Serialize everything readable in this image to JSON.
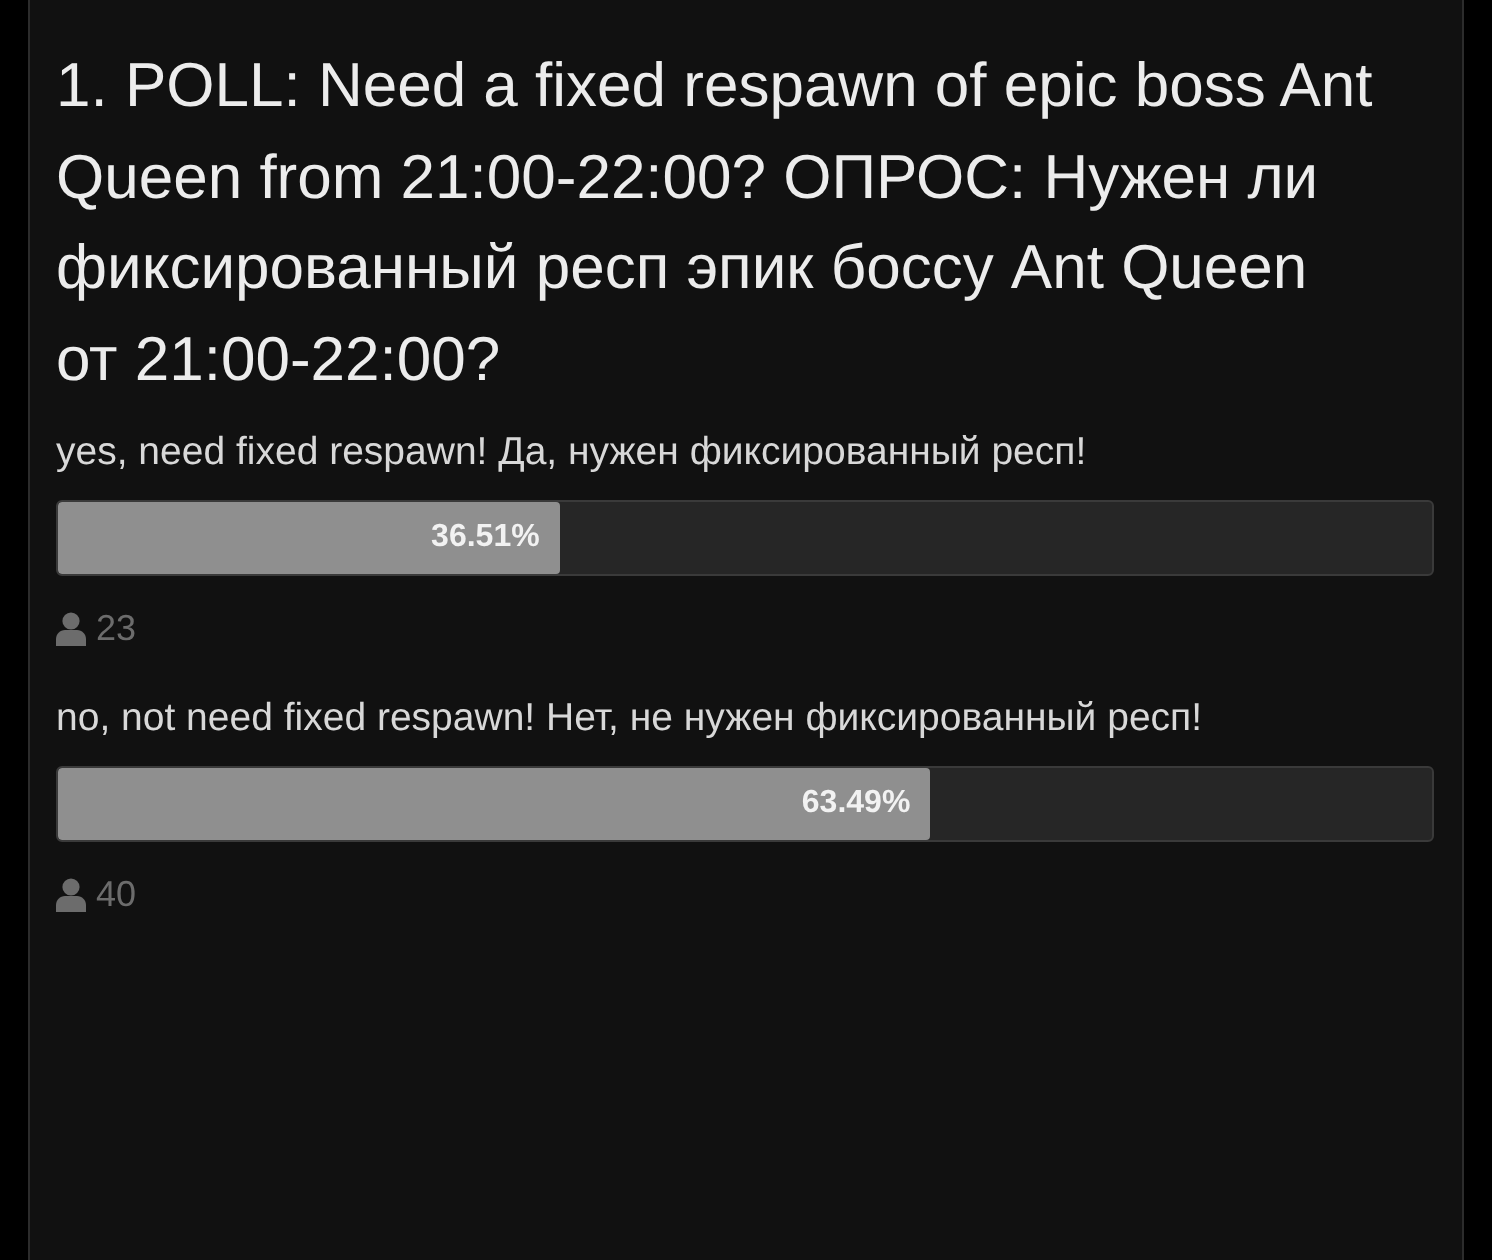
{
  "poll": {
    "question": "1. POLL: Need a fixed respawn of epic boss Ant Queen from 21:00-22:00? ОПРОС: Нужен ли фиксированный респ эпик боссу Ant Queen от 21:00-22:00?",
    "options": [
      {
        "label": "yes, need fixed respawn! Да, нужен фиксированный респ!",
        "level": 0.3651,
        "percent": "36.51%",
        "votes": "23"
      },
      {
        "label": "no, not need fixed respawn! Нет, не нужен фиксированный респ!",
        "level": 0.6349,
        "percent": "63.49%",
        "votes": "40"
      }
    ]
  }
}
